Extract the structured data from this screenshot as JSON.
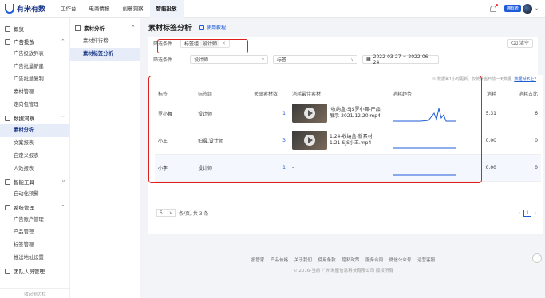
{
  "header": {
    "logo_text": "有米有数",
    "nav": [
      "工作台",
      "电商情报",
      "创意洞察",
      "智能投放"
    ],
    "active_nav_index": 3,
    "owner_badge": "拥有者"
  },
  "sidebar": {
    "groups": [
      {
        "label": "概览",
        "icon": "overview-icon",
        "items": []
      },
      {
        "label": "广告投放",
        "icon": "ad-icon",
        "items": [
          "广告投放列表",
          "广告批量新建",
          "广告批量复制",
          "素材管理",
          "定向包管理"
        ]
      },
      {
        "label": "数据洞察",
        "icon": "chart-icon",
        "items": [
          "素材分析",
          "文案报表",
          "自定义报表",
          "人效报表"
        ]
      },
      {
        "label": "智能工具",
        "icon": "tool-icon",
        "items": [
          "自动化预警"
        ]
      },
      {
        "label": "系统管理",
        "icon": "settings-icon",
        "items": [
          "广告账户管理",
          "产品管理",
          "标签管理",
          "推送地址设置"
        ]
      },
      {
        "label": "团队人员管理",
        "icon": "team-icon",
        "items": []
      }
    ],
    "active_item": "素材分析",
    "collapse_label": "收起侧边栏"
  },
  "subnav": {
    "title": "素材分析",
    "items": [
      "素材排行榜",
      "素材标签分析"
    ],
    "active_index": 1
  },
  "page": {
    "title": "素材标签分析",
    "tutorial": "使用教程"
  },
  "filters": {
    "row1_label": "筛选条件",
    "tag_group_label": "标签组",
    "tag_group_value": "设计师",
    "clear_label": "清空",
    "row2_label": "筛选条件",
    "select1": "设计师",
    "select2": "标签",
    "date_range": "2022-03-27 ~ 2022-06-24"
  },
  "table": {
    "hint": "① 数据每1小时更新，仅统计当日前一天数据,",
    "hint_link": "数据对不上?",
    "columns": [
      "标签",
      "标签组",
      "关联素材数",
      "消耗最佳素材",
      "消耗趋势",
      "消耗",
      "消耗占比"
    ],
    "rows": [
      {
        "tag": "罗小舞",
        "group": "设计师",
        "count": "1",
        "best": "·收纳盒-SJS罗小舞-产品展示-2021.12.20.mp4",
        "cost": "5.31",
        "share": "6"
      },
      {
        "tag": "小王",
        "group": "拍摄,设计师",
        "count": "3",
        "best": "1.24-收纳盒-新素材1.21-SJS小王.mp4",
        "cost": "0.00",
        "share": "0"
      },
      {
        "tag": "小李",
        "group": "设计师",
        "count": "1",
        "best": "-",
        "cost": "0.00",
        "share": "0"
      }
    ],
    "page_size": "5",
    "page_size_unit": "条/页, 共 3 条",
    "current_page": "1"
  },
  "footer": {
    "links": [
      "投管家",
      "产品价格",
      "关于我们",
      "使用条款",
      "隐私政策",
      "服务合同",
      "微信公众号",
      "运营客服"
    ],
    "copyright": "© 2016-当前 广州米屋信息科技有限公司 版权所有"
  },
  "colors": {
    "accent": "#1e5bd8",
    "highlight": "#e02020"
  }
}
